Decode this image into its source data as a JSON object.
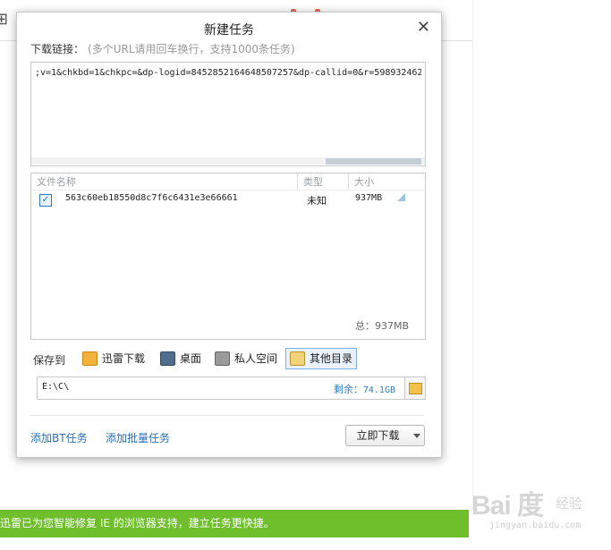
{
  "dialog": {
    "title": "新建任务",
    "close_glyph": "✕",
    "url_label": "下载链接：",
    "url_hint": "(多个URL请用回车换行，支持1000条任务)",
    "url_value": ";v=1&chkbd=1&chkpc=&dp-logid=8452852164648507257&dp-callid=0&r=598932462"
  },
  "file_table": {
    "headers": {
      "name": "文件名称",
      "type": "类型",
      "size": "大小"
    },
    "rows": [
      {
        "checked": true,
        "check_glyph": "✓",
        "name": "563c60eb18550d8c7f6c6431e3e66661",
        "type": "未知",
        "size": "937MB"
      }
    ],
    "total": "总：937MB"
  },
  "save": {
    "label": "保存到",
    "options": [
      {
        "label": "迅雷下载",
        "icon": "thunder-folder-icon"
      },
      {
        "label": "桌面",
        "icon": "desktop-icon"
      },
      {
        "label": "私人空间",
        "icon": "private-space-icon"
      },
      {
        "label": "其他目录",
        "icon": "other-folder-icon",
        "selected": true
      }
    ],
    "path": "E:\\C\\",
    "remaining_label": "剩余：",
    "remaining_value": "74.1GB"
  },
  "actions": {
    "add_bt": "添加BT任务",
    "add_batch": "添加批量任务",
    "download_now": "立即下载"
  },
  "background": {
    "status_bar_text": "迅雷已为您智能修复 IE 的浏览器支持，建立任务更快捷。",
    "watermark_logo": "Bai 度",
    "watermark_sub": "经验",
    "watermark_url": "jingyan.baidu.com"
  },
  "colors": {
    "status_bar": "#6fbf2c",
    "link": "#2a6fb0",
    "remaining": "#2f7fc1"
  }
}
